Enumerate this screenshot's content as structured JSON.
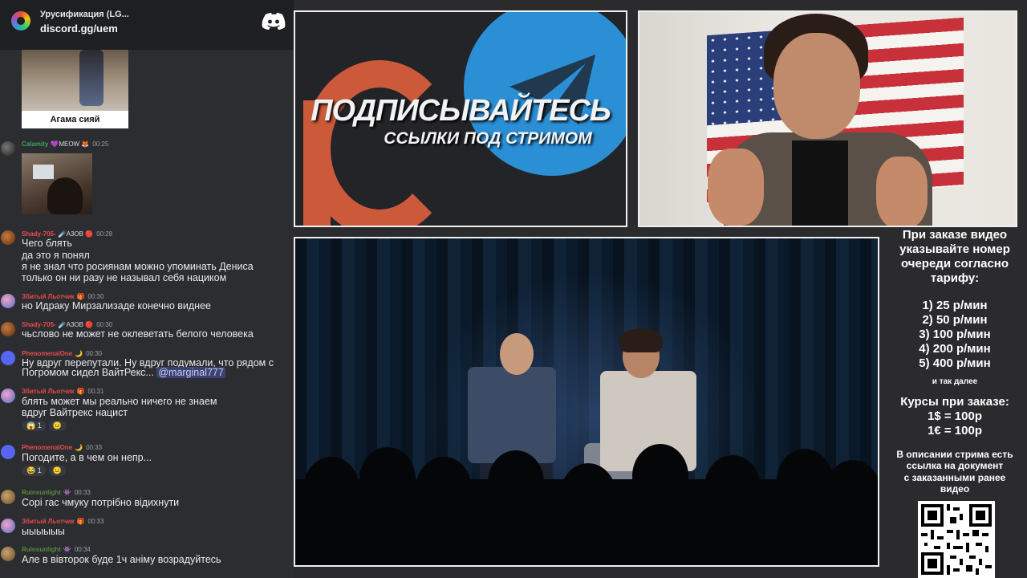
{
  "header": {
    "server_name": "Урусификация (LG...",
    "invite_link": "discord.gg/uem"
  },
  "attachments": {
    "image_caption": "Агама сияй"
  },
  "messages": [
    {
      "user": "Calamity",
      "user_color": "#3ba55c",
      "badge": "💜MEOW 🦊",
      "time": "00:25"
    },
    {
      "user": "Shady-705-",
      "user_color": "#e84b4b",
      "badge": "☄️A3OB 🔴",
      "time": "00:28",
      "lines": [
        "Чего блять",
        "да это я понял",
        "я не знал что росиянам можно упоминать Дениса",
        "только он ни разу не называл себя нациком"
      ]
    },
    {
      "user": "Збитый Льотчик",
      "user_color": "#e84b4b",
      "badge": "🎁",
      "time": "00:30",
      "lines": [
        "но Идраку Мирзализаде конечно виднее"
      ]
    },
    {
      "user": "Shady-705-",
      "user_color": "#e84b4b",
      "badge": "☄️A3OB 🔴",
      "time": "00:30",
      "lines": [
        "чьслово не может не оклеветать белого человека"
      ]
    },
    {
      "user": "PhenomenalOne",
      "user_color": "#e84b4b",
      "badge": "🌙",
      "time": "00:30",
      "lines": [
        "Ну вдруг перепутали. Ну вдруг подумали, что рядом с",
        "Погромом сидел ВайтРекс..."
      ],
      "mention": "@marginal777"
    },
    {
      "user": "Збитый Льотчик",
      "user_color": "#e84b4b",
      "badge": "🎁",
      "time": "00:31",
      "lines": [
        "блять может мы реально ничего не знаем",
        "вдруг Вайтрекс нацист"
      ],
      "reactions": [
        "😱 1",
        "😐"
      ]
    },
    {
      "user": "PhenomenalOne",
      "user_color": "#e84b4b",
      "badge": "🌙",
      "time": "00:33",
      "lines": [
        "Погодите, а в чем он непр..."
      ],
      "reactions": [
        "😂 1",
        "😐"
      ]
    },
    {
      "user": "Ruinsunlight",
      "user_color": "#5a8a3a",
      "badge": "👾",
      "time": "00:33",
      "lines": [
        "Сорі гас чмуку потрібно відихнути"
      ]
    },
    {
      "user": "Збитый Льотчик",
      "user_color": "#e84b4b",
      "badge": "🎁",
      "time": "00:33",
      "lines": [
        "ыыыыыы"
      ]
    },
    {
      "user": "Ruinsunlight",
      "user_color": "#5a8a3a",
      "badge": "👾",
      "time": "00:34",
      "lines": [
        "Але в вівторок буде 1ч аніму возрадуйтесь"
      ]
    }
  ],
  "promo": {
    "title": "ПОДПИСЫВАЙТЕСЬ",
    "subtitle": "ССЫЛКИ ПОД СТРИМОМ",
    "p_color": "#cc5a3a",
    "tg_color": "#2b8fd6"
  },
  "info": {
    "heading_lines": [
      "При заказе видео",
      "указывайте номер",
      "очереди согласно",
      "тарифу:"
    ],
    "tariffs": [
      "1) 25 р/мин",
      "2) 50 р/мин",
      "3) 100 р/мин",
      "4) 200 р/мин",
      "5) 400 р/мин"
    ],
    "tariff_more": "и так далее",
    "rates_title": "Курсы при заказе:",
    "rates": [
      "1$ = 100р",
      "1€ = 100р"
    ],
    "desc_lines": [
      "В описании стрима есть",
      "ссылка на документ",
      "с заказанными ранее",
      "видео"
    ]
  }
}
